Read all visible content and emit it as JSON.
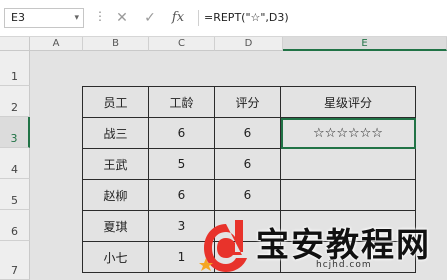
{
  "formula_bar": {
    "name_box": "E3",
    "cancel_glyph": "✕",
    "enter_glyph": "✓",
    "fx_label": "fx",
    "formula": "=REPT(\"☆\",D3)"
  },
  "columns": [
    "A",
    "B",
    "C",
    "D",
    "E"
  ],
  "rows": [
    "1",
    "2",
    "3",
    "4",
    "5",
    "6",
    "7"
  ],
  "selected_cell": "E3",
  "table": {
    "headers": [
      "员工",
      "工龄",
      "评分",
      "星级评分"
    ],
    "rows": [
      [
        "战三",
        "6",
        "6",
        "☆☆☆☆☆☆"
      ],
      [
        "王武",
        "5",
        "6",
        ""
      ],
      [
        "赵柳",
        "6",
        "6",
        ""
      ],
      [
        "夏琪",
        "3",
        "",
        ""
      ],
      [
        "小七",
        "1",
        "",
        ""
      ]
    ]
  },
  "watermark": {
    "text": "宝安教程网",
    "url": "hcjhd.com",
    "logo_colors": [
      "#e8332b",
      "#f5a623"
    ]
  }
}
